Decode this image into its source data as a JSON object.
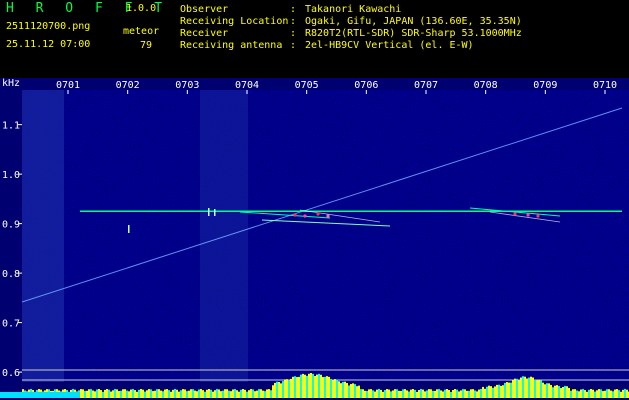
{
  "app": {
    "name": "H R O F F T",
    "version": "1.0.0"
  },
  "file": {
    "name": "2511120700.png",
    "datetime": "25.11.12 07:00"
  },
  "meteor": {
    "label": "meteor",
    "count": "79"
  },
  "info": [
    {
      "key": "Observer",
      "sep": ":",
      "value": "Takanori Kawachi"
    },
    {
      "key": "Receiving Location",
      "sep": ":",
      "value": "Ogaki, Gifu, JAPAN (136.60E, 35.35N)"
    },
    {
      "key": "Receiver",
      "sep": ":",
      "value": "R820T2(RTL-SDR) SDR-Sharp 53.1000MHz"
    },
    {
      "key": "Receiving antenna",
      "sep": ":",
      "value": "2el-HB9CV Vertical (el. E-W)"
    }
  ],
  "chart_data": {
    "type": "heatmap",
    "ylabel": "kHz",
    "x_ticks": [
      "0701",
      "0702",
      "0703",
      "0704",
      "0705",
      "0706",
      "0707",
      "0708",
      "0709",
      "0710"
    ],
    "y_ticks": [
      "1.1",
      "1.0",
      "0.9",
      "0.8",
      "0.7",
      "0.6"
    ],
    "y_range": [
      0.58,
      1.17
    ],
    "carrier_khz": 0.925,
    "colors": {
      "text": "#ffff00",
      "logo": "#00ff40",
      "background": "#000088",
      "carrier": "#00ff80",
      "axis": "#ffffff"
    }
  }
}
